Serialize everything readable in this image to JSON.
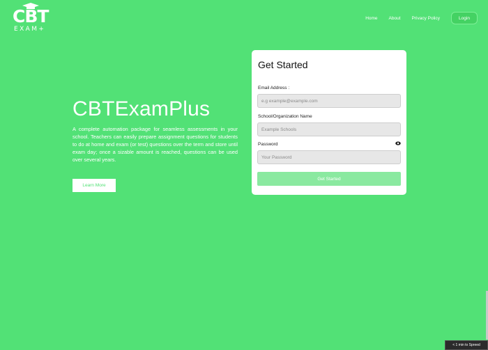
{
  "logo": {
    "line1": "CBT",
    "line2": "EXAM+"
  },
  "nav": {
    "home": "Home",
    "about": "About",
    "privacy": "Privacy Policy",
    "login": "Login"
  },
  "hero": {
    "title": "CBTExamPlus",
    "text": "A complete automation package for seamless assessments in your school. Teachers can easily prepare assignment questions for students to do at home and exam (or test) questions over the term and store until exam day; once a sizable amount is reached, questions can be used over several years.",
    "learn_more": "Learn More"
  },
  "form": {
    "title": "Get Started",
    "email_label": "Email Address :",
    "email_placeholder": "e.g example@example.com",
    "school_label": "School/Organization Name",
    "school_placeholder": "Example Schools",
    "password_label": "Password",
    "password_placeholder": "Your Password",
    "submit": "Get Started"
  },
  "widget": {
    "text": "< 1 min to Spreed"
  },
  "colors": {
    "background": "#52e176",
    "button_disabled": "#8ae9a0"
  }
}
